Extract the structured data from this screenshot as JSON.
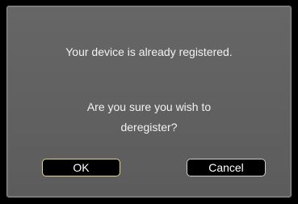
{
  "dialog": {
    "message": "Your device is already registered.",
    "question_line1": "Are you sure you wish to",
    "question_line2": "deregister?"
  },
  "buttons": {
    "ok_label": "OK",
    "cancel_label": "Cancel",
    "focused": "OK"
  },
  "colors": {
    "background": "#000000",
    "dialog_fill": "#606060",
    "text": "#f2f2f2",
    "button_fill": "#000000",
    "focus_border": "#e3d68a"
  }
}
